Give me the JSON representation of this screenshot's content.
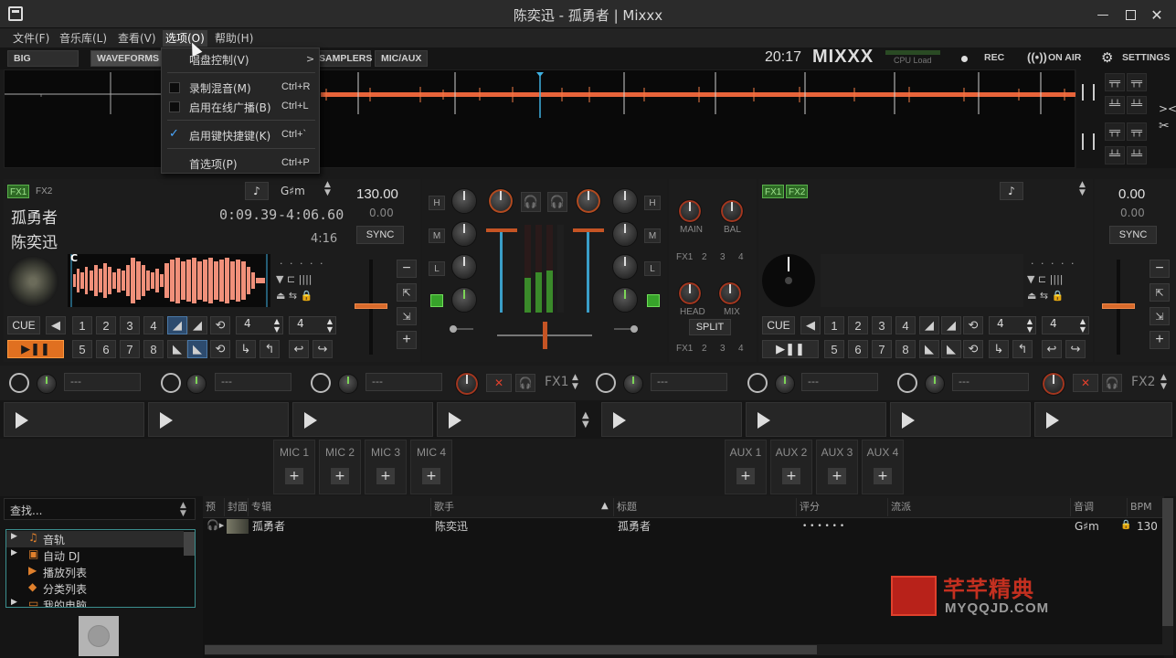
{
  "window": {
    "title": "陈奕迅 - 孤勇者 | Mixxx"
  },
  "menubar": {
    "items": [
      "文件(F)",
      "音乐库(L)",
      "查看(V)",
      "选项(O)",
      "帮助(H)"
    ]
  },
  "toolbar": {
    "big_library": "BIG LIBRARY",
    "waveforms": "WAVEFORMS",
    "samplers": "SAMPLERS",
    "mic_aux": "MIC/AUX",
    "clock": "20:17",
    "logo": "MIXXX",
    "cpu_load": "CPU Load",
    "rec": "REC",
    "on_air": "ON AIR",
    "settings": "SETTINGS"
  },
  "options_menu": {
    "vinyl_control": "唱盘控制(V)",
    "record_mix": "录制混音(M)",
    "record_mix_shortcut": "Ctrl+R",
    "live_broadcast": "启用在线广播(B)",
    "live_broadcast_shortcut": "Ctrl+L",
    "keyboard_shortcuts": "启用键快捷键(K)",
    "keyboard_shortcuts_shortcut": "Ctrl+`",
    "preferences": "首选项(P)",
    "preferences_shortcut": "Ctrl+P"
  },
  "deck1": {
    "fx1": "FX1",
    "fx2": "FX2",
    "key": "G♯m",
    "title": "孤勇者",
    "artist": "陈奕迅",
    "elapsed": "0:09.39",
    "remaining": "-4:06.60",
    "duration": "4:16",
    "bpm": "130.00",
    "rate": "0.00",
    "sync": "SYNC",
    "cue": "CUE",
    "cue_marker": "C",
    "beatloop_size": "4",
    "beatjump_size": "4",
    "hotcues": [
      "1",
      "2",
      "3",
      "4",
      "5",
      "6",
      "7",
      "8"
    ]
  },
  "deck2": {
    "fx1": "FX1",
    "fx2": "FX2",
    "bpm": "0.00",
    "rate": "0.00",
    "sync": "SYNC",
    "cue": "CUE",
    "beatloop_size": "4",
    "beatjump_size": "4",
    "hotcues": [
      "1",
      "2",
      "3",
      "4",
      "5",
      "6",
      "7",
      "8"
    ]
  },
  "mixer": {
    "eq_high": "H",
    "eq_mid": "M",
    "eq_low": "L",
    "main": "MAIN",
    "bal": "BAL",
    "head": "HEAD",
    "mix": "MIX",
    "split": "SPLIT",
    "fx_assign": [
      "FX1",
      "2",
      "3",
      "4"
    ]
  },
  "fx_rack": {
    "unit1_label": "FX1",
    "unit2_label": "FX2",
    "effect_placeholder": "---"
  },
  "mic_aux": {
    "mics": [
      "MIC 1",
      "MIC 2",
      "MIC 3",
      "MIC 4"
    ],
    "auxes": [
      "AUX 1",
      "AUX 2",
      "AUX 3",
      "AUX 4"
    ]
  },
  "library": {
    "search_placeholder": "查找...",
    "tree": [
      "音轨",
      "自动 DJ",
      "播放列表",
      "分类列表",
      "我的电脑"
    ],
    "columns": [
      "预览",
      "封面",
      "专辑",
      "歌手",
      "标题",
      "评分",
      "流派",
      "音调",
      "BPM"
    ],
    "rows": [
      {
        "album": "孤勇者",
        "artist": "陈奕迅",
        "title": "孤勇者",
        "rating": "• • • • • •",
        "genre": "",
        "key": "G♯m",
        "bpm": "130"
      }
    ]
  },
  "watermark": {
    "name": "芊芊精典",
    "site": "MYQQJD.COM"
  },
  "colors": {
    "waveform": "#e8643a",
    "play_orange": "#e07020",
    "fx_green": "#59b04b",
    "accent_red": "#c43020"
  }
}
